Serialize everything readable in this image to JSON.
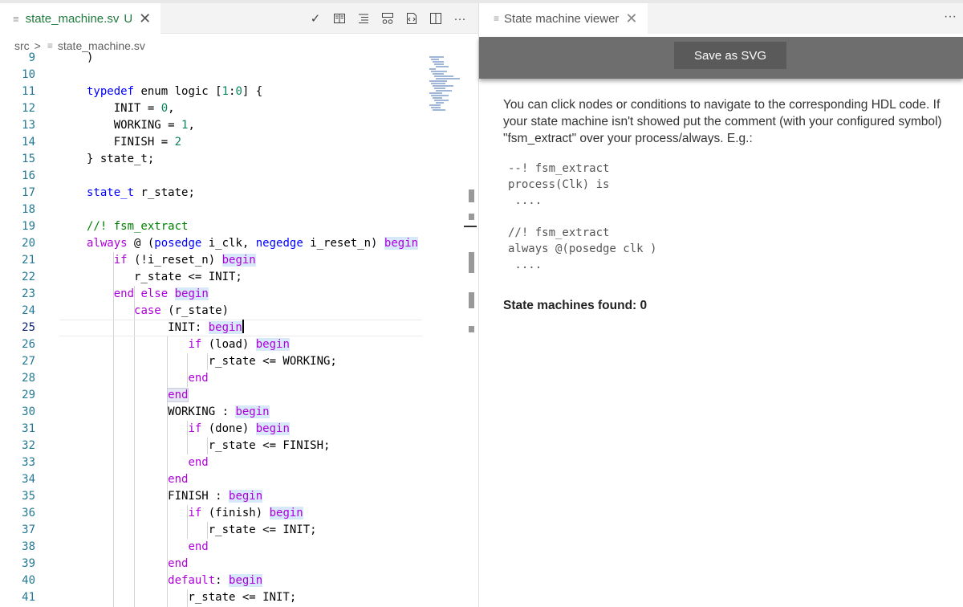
{
  "editor": {
    "tab": {
      "filename": "state_machine.sv",
      "modified_marker": "U"
    },
    "breadcrumb": {
      "folder": "src",
      "file": "state_machine.sv"
    },
    "code_lines": [
      {
        "n": "9",
        "html": ")"
      },
      {
        "n": "10",
        "html": ""
      },
      {
        "n": "11",
        "html": "<span class='kw'>typedef</span> enum logic [<span class='num'>1</span>:<span class='num'>0</span>] {"
      },
      {
        "n": "12",
        "html": "    INIT = <span class='num'>0</span>,"
      },
      {
        "n": "13",
        "html": "    WORKING = <span class='num'>1</span>,"
      },
      {
        "n": "14",
        "html": "    FINISH = <span class='num'>2</span>"
      },
      {
        "n": "15",
        "html": "} state_t;"
      },
      {
        "n": "16",
        "html": ""
      },
      {
        "n": "17",
        "html": "<span class='kw'>state_t</span> r_state;"
      },
      {
        "n": "18",
        "html": ""
      },
      {
        "n": "19",
        "html": "<span class='cmt'>//! fsm_extract</span>"
      },
      {
        "n": "20",
        "html": "<span class='kw2'>always</span> @ (<span class='kw'>posedge</span> i_clk, <span class='kw'>negedge</span> i_reset_n) <span class='kw2 hl'>begin</span>"
      },
      {
        "n": "21",
        "html": "    <span class='kw2'>if</span> (!i_reset_n) <span class='kw2 hl'>begin</span>"
      },
      {
        "n": "22",
        "html": "       r_state &lt;= INIT;"
      },
      {
        "n": "23",
        "html": "    <span class='kw2'>end</span> <span class='kw2'>else</span> <span class='kw2 hl'>begin</span>"
      },
      {
        "n": "24",
        "html": "       <span class='kw2'>case</span> (r_state)"
      },
      {
        "n": "25",
        "html": "            INIT: <span class='kw2 hl'>begin</span><span class='caret'></span>",
        "current": true
      },
      {
        "n": "26",
        "html": "               <span class='kw2'>if</span> (load) <span class='kw2 hl'>begin</span>"
      },
      {
        "n": "27",
        "html": "                  r_state &lt;= WORKING;"
      },
      {
        "n": "28",
        "html": "               <span class='kw2'>end</span>"
      },
      {
        "n": "29",
        "html": "            <span class='kw2 hl2'>end</span>"
      },
      {
        "n": "30",
        "html": "            WORKING : <span class='kw2 hl'>begin</span>"
      },
      {
        "n": "31",
        "html": "               <span class='kw2'>if</span> (done) <span class='kw2 hl'>begin</span>"
      },
      {
        "n": "32",
        "html": "                  r_state &lt;= FINISH;"
      },
      {
        "n": "33",
        "html": "               <span class='kw2'>end</span>"
      },
      {
        "n": "34",
        "html": "            <span class='kw2'>end</span>"
      },
      {
        "n": "35",
        "html": "            FINISH : <span class='kw2 hl'>begin</span>"
      },
      {
        "n": "36",
        "html": "               <span class='kw2'>if</span> (finish) <span class='kw2 hl'>begin</span>"
      },
      {
        "n": "37",
        "html": "                  r_state &lt;= INIT;"
      },
      {
        "n": "38",
        "html": "               <span class='kw2'>end</span>"
      },
      {
        "n": "39",
        "html": "            <span class='kw2'>end</span>"
      },
      {
        "n": "40",
        "html": "            <span class='kw2'>default</span>: <span class='kw2 hl'>begin</span>"
      },
      {
        "n": "41",
        "html": "               r_state &lt;= INIT;"
      }
    ]
  },
  "viewer": {
    "tab_title": "State machine viewer",
    "save_button": "Save as SVG",
    "help_text": "You can click nodes or conditions to navigate to the corresponding HDL code. If your state machine isn't showed put the comment (with your configured symbol) \"fsm_extract\" over your process/always. E.g.:",
    "example_vhdl": "--! fsm_extract\nprocess(Clk) is\n ....",
    "example_verilog": "//! fsm_extract\nalways @(posedge clk )\n ....",
    "found_text": "State machines found: 0"
  },
  "icons": [
    "file-lines-icon",
    "close-icon",
    "check-icon",
    "preview-icon",
    "outline-icon",
    "diagram-icon",
    "code-file-icon",
    "split-editor-icon",
    "more-actions-icon"
  ]
}
